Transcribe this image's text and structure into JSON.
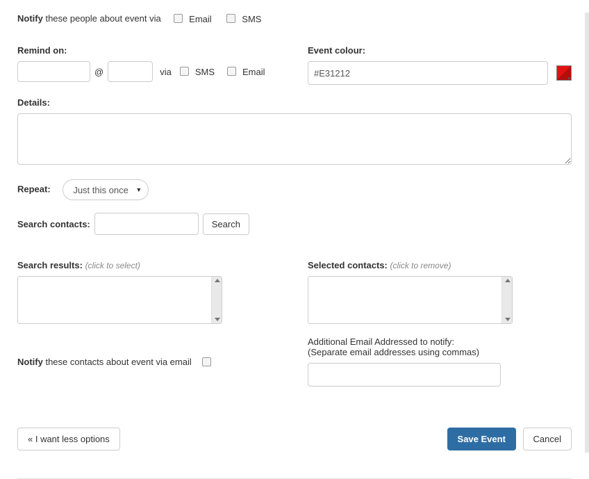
{
  "notify_people": {
    "prefix_bold": "Notify",
    "suffix": " these people about event via",
    "email_label": "Email",
    "sms_label": "SMS"
  },
  "remind": {
    "label": "Remind on:",
    "at": "@",
    "via": "via",
    "sms_label": "SMS",
    "email_label": "Email",
    "date_value": "",
    "time_value": ""
  },
  "event_colour": {
    "label": "Event colour:",
    "value": "#E31212"
  },
  "details": {
    "label": "Details:",
    "value": ""
  },
  "repeat": {
    "label": "Repeat:",
    "selected": "Just this once",
    "options": [
      "Just this once"
    ]
  },
  "search_contacts": {
    "label": "Search contacts:",
    "value": "",
    "button": "Search"
  },
  "search_results": {
    "label": "Search results:",
    "hint": "(click to select)"
  },
  "selected_contacts": {
    "label": "Selected contacts:",
    "hint": "(click to remove)"
  },
  "notify_contacts": {
    "prefix_bold": "Notify",
    "suffix": " these contacts about event via email"
  },
  "additional_emails": {
    "label": "Additional Email Addressed to notify:",
    "hint": "(Separate email addresses using commas)",
    "value": ""
  },
  "footer": {
    "less": "« I want less options",
    "save": "Save Event",
    "cancel": "Cancel"
  }
}
